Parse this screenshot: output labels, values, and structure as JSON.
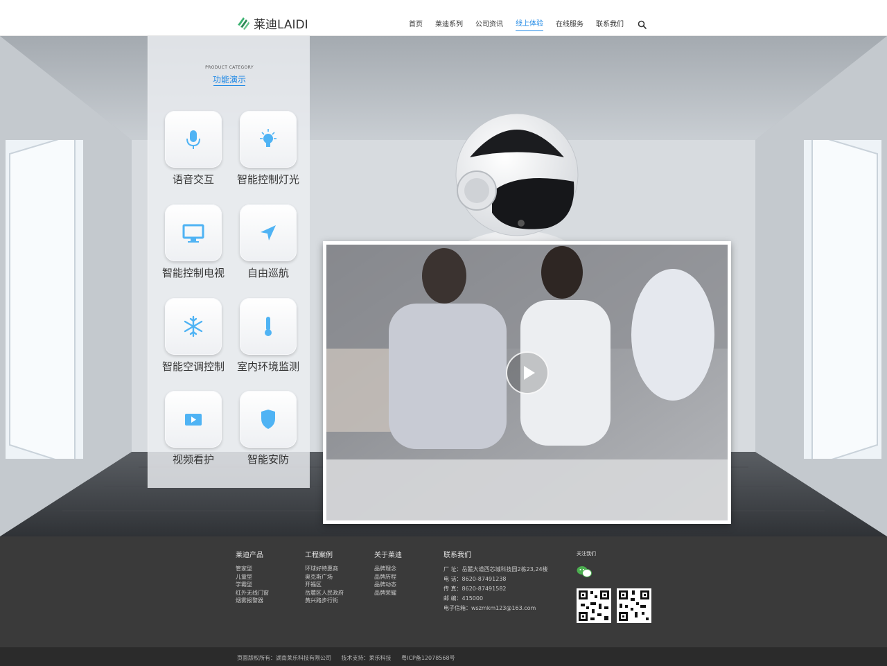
{
  "header": {
    "logo_text": "莱迪LAIDI",
    "nav": [
      {
        "label": "首页",
        "active": false
      },
      {
        "label": "莱迪系列",
        "active": false
      },
      {
        "label": "公司资讯",
        "active": false
      },
      {
        "label": "线上体验",
        "active": true
      },
      {
        "label": "在线服务",
        "active": false
      },
      {
        "label": "联系我们",
        "active": false
      }
    ],
    "search_icon": "search-icon"
  },
  "panel": {
    "title_en": "PRODUCT CATEGORY",
    "title_cn": "功能演示",
    "functions": [
      {
        "label": "语音交互",
        "icon": "microphone-icon"
      },
      {
        "label": "智能控制灯光",
        "icon": "lightbulb-icon"
      },
      {
        "label": "智能控制电视",
        "icon": "monitor-icon"
      },
      {
        "label": "自由巡航",
        "icon": "navigation-arrow-icon"
      },
      {
        "label": "智能空调控制",
        "icon": "snowflake-icon"
      },
      {
        "label": "室内环境监测",
        "icon": "thermometer-icon"
      },
      {
        "label": "视频看护",
        "icon": "video-play-icon"
      },
      {
        "label": "智能安防",
        "icon": "shield-icon"
      }
    ],
    "icon_color": "#4fb3f4"
  },
  "video": {
    "play_icon": "play-icon"
  },
  "footer": {
    "products": {
      "title": "莱迪产品",
      "items": [
        "管家型",
        "儿童型",
        "学霸型",
        "红外无线门窗",
        "烟雾报警器"
      ]
    },
    "cases": {
      "title": "工程案例",
      "items": [
        "环球好特惠商",
        "奥克斯广场",
        "开福区",
        "岳麓区人民政府",
        "黄兴路步行街"
      ]
    },
    "about": {
      "title": "关于莱迪",
      "items": [
        "品牌理念",
        "品牌历程",
        "品牌动态",
        "品牌荣耀"
      ]
    },
    "contact": {
      "title": "联系我们",
      "items": [
        "厂 址：岳麓大道西芯城科技园2栋23,24楼",
        "电 话：8620-87491238",
        "传 真：8620-87491582",
        "邮 编：415000",
        "电子信箱：wszmkm123@163.com"
      ]
    },
    "follow": {
      "title": "关注我们",
      "icon": "wechat-icon"
    },
    "copyright": [
      "页面版权所有：湖南莱乐科技有限公司",
      "技术支持：莱乐科技",
      "粤ICP备12078568号"
    ]
  },
  "colors": {
    "accent": "#1e88e5",
    "footer_bg": "#3a3a3a",
    "bottom_bar_bg": "#2b2b2b"
  }
}
